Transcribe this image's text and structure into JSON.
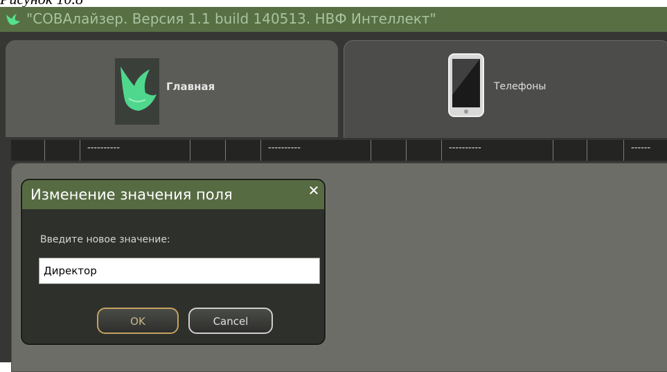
{
  "caption": "Рисунок 10.8",
  "window": {
    "title": "\"СОВАлайзер. Версия 1.1 build 140513. НВФ Интеллект\""
  },
  "tabs": [
    {
      "label": "Главная",
      "icon": "owl-icon"
    },
    {
      "label": "Телефоны",
      "icon": "tablet-icon"
    }
  ],
  "columns": [
    "",
    "",
    "----------",
    "",
    "",
    "----------",
    "",
    "",
    "----------",
    "",
    "",
    "------"
  ],
  "dialog": {
    "title": "Изменение значения поля",
    "prompt": "Введите новое значение:",
    "value": "Директор",
    "ok_label": "OK",
    "cancel_label": "Cancel"
  },
  "colors": {
    "titlebar": "#586f44",
    "background": "#363734",
    "content": "#6c6d66",
    "ok_border": "#c6a35f"
  }
}
